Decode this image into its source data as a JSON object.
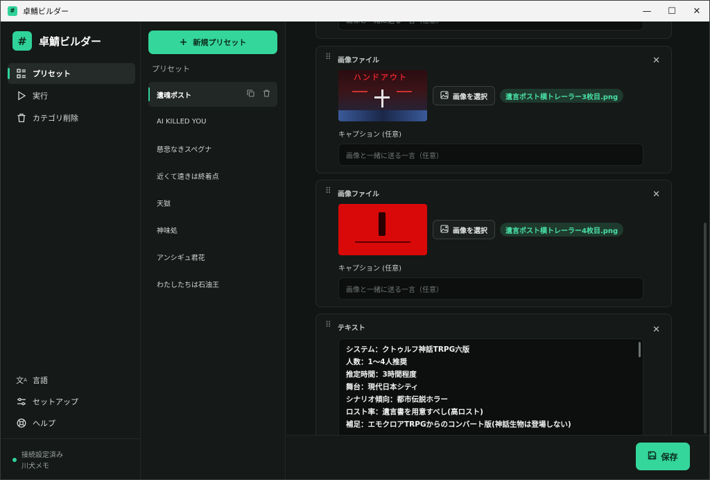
{
  "window": {
    "title": "卓鯖ビルダー"
  },
  "brand": {
    "name": "卓鯖ビルダー",
    "icon": "#"
  },
  "nav": [
    {
      "label": "プリセット",
      "icon": "grid-list-icon",
      "active": true
    },
    {
      "label": "実行",
      "icon": "play-icon",
      "active": false
    },
    {
      "label": "カテゴリ削除",
      "icon": "trash-icon",
      "active": false
    }
  ],
  "nav_bottom": [
    {
      "label": "言語",
      "icon": "translate-icon"
    },
    {
      "label": "セットアップ",
      "icon": "sliders-icon"
    },
    {
      "label": "ヘルプ",
      "icon": "lifebuoy-icon"
    }
  ],
  "status": {
    "line1": "接続設定済み",
    "line2": "川犬メモ",
    "color": "#2fd39a"
  },
  "presets": {
    "new_button": "新規プリセット",
    "label": "プリセット",
    "items": [
      "遺魂ポスト",
      "AI KILLED YOU",
      "慈悲なきスペグナ",
      "近くて遠きは終着点",
      "天獄",
      "神味処",
      "アンシギュ君花",
      "わたしたちは石油王"
    ]
  },
  "cards": {
    "top_caption_placeholder": "画像と一緒に送る一言（任意）",
    "image1": {
      "title": "画像ファイル",
      "thumb_text": "ハンドアウト",
      "pick_label": "画像を選択",
      "file": "遺言ポスト横トレーラー3枚目.png",
      "caption_label": "キャプション (任意)",
      "caption_placeholder": "画像と一緒に送る一言（任意）"
    },
    "image2": {
      "title": "画像ファイル",
      "pick_label": "画像を選択",
      "file": "遺言ポスト横トレーラー4枚目.png",
      "caption_label": "キャプション (任意)",
      "caption_placeholder": "画像と一緒に送る一言（任意）"
    },
    "text": {
      "title": "テキスト",
      "lines": [
        "システム：クトゥルフ神話TRPG六版",
        "人数：1〜4人推奨",
        "推定時間：3時間程度",
        "舞台：現代日本シティ",
        "シナリオ傾向：都市伝説ホラー",
        "ロスト率：遺言書を用意すべし(高ロスト)",
        "補足：エモクロアTRPGからのコンバート版(神話生物は登場しない)"
      ]
    }
  },
  "footer": {
    "save_label": "保存"
  },
  "colors": {
    "accent": "#34d69b",
    "background": "#121614"
  }
}
